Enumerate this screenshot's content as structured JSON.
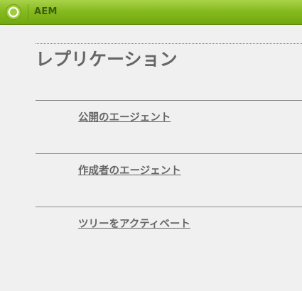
{
  "header": {
    "app_name": "AEM",
    "logo_icon": "aem-logo-icon"
  },
  "page": {
    "title": "レプリケーション"
  },
  "links": [
    {
      "label": "公開のエージェント"
    },
    {
      "label": "作成者のエージェント"
    },
    {
      "label": "ツリーをアクティベート"
    }
  ],
  "colors": {
    "header_green": "#86bb1f",
    "text_gray": "#666666",
    "background": "#f0f0f0"
  }
}
